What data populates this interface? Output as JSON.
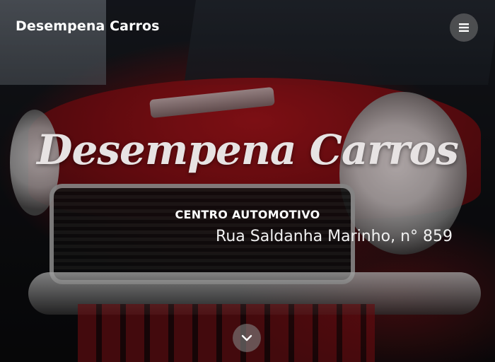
{
  "navbar": {
    "brand": "Desempena Carros",
    "menu_icon": "hamburger-menu-icon"
  },
  "hero": {
    "title": "Desempena Carros",
    "subtitle": "CENTRO AUTOMOTIVO",
    "address": "Rua Saldanha Marinho, n° 859",
    "scroll_icon": "chevron-down-icon",
    "background_image": "red vintage car front (grille, round headlights, chrome bumper)"
  },
  "colors": {
    "text": "#ffffff",
    "title": "#e7e3e3",
    "button_bg": "rgba(120,120,120,0.55)",
    "car_red": "#a3141b"
  }
}
